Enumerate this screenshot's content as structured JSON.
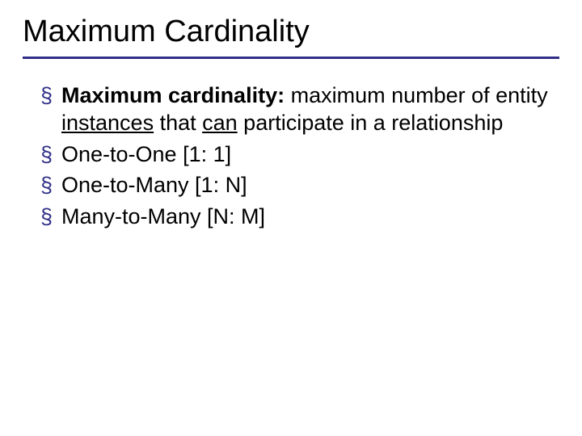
{
  "slide": {
    "title": "Maximum Cardinality",
    "bullets": [
      {
        "term": "Maximum cardinality:",
        "pre": " maximum number of entity ",
        "u1": "instances",
        "mid": " that ",
        "u2": "can",
        "post": " participate in a relationship"
      },
      {
        "text": "One-to-One [1: 1]"
      },
      {
        "text": "One-to-Many [1: N]"
      },
      {
        "text": "Many-to-Many [N: M]"
      }
    ]
  },
  "colors": {
    "accent": "#2f2f87"
  }
}
